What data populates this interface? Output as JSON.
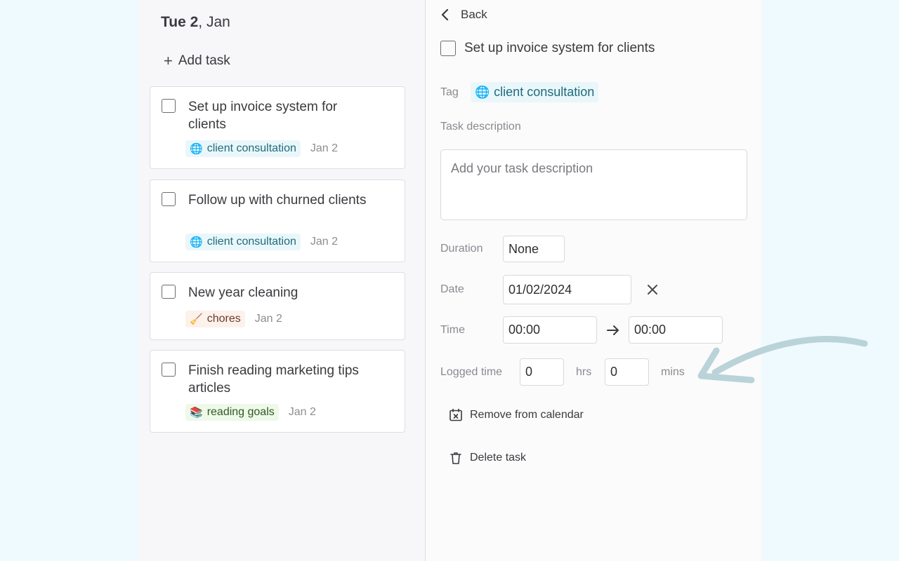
{
  "day": {
    "bold": "Tue 2",
    "rest": ", Jan"
  },
  "add_task_label": "Add task",
  "tasks": [
    {
      "title": "Set up invoice system for clients",
      "tag": "client consultation",
      "tag_icon": "globe-icon",
      "date": "Jan 2"
    },
    {
      "title": "Follow up with churned clients",
      "tag": "client consultation",
      "tag_icon": "globe-icon",
      "date": "Jan 2"
    },
    {
      "title": "New year cleaning",
      "tag": "chores",
      "tag_icon": "broom-icon",
      "date": "Jan 2"
    },
    {
      "title": "Finish reading marketing tips articles",
      "tag": "reading goals",
      "tag_icon": "books-icon",
      "date": "Jan 2"
    }
  ],
  "detail": {
    "back_label": "Back",
    "title": "Set up invoice system for clients",
    "tag_label": "Tag",
    "tag_value": "client consultation",
    "description_label": "Task description",
    "description_placeholder": "Add your task description",
    "duration_label": "Duration",
    "duration_value": "None",
    "date_label": "Date",
    "date_value": "01/02/2024",
    "time_label": "Time",
    "time_start": "00:00",
    "time_end": "00:00",
    "logged_label": "Logged time",
    "logged_hours": "0",
    "hours_unit": "hrs",
    "logged_mins": "0",
    "mins_unit": "mins",
    "remove_calendar_label": "Remove from calendar",
    "delete_label": "Delete task"
  },
  "colors": {
    "background": "#eefafe",
    "tag_blue": "#1f6b7d",
    "annotation_arrow": "#b9d3d9"
  }
}
